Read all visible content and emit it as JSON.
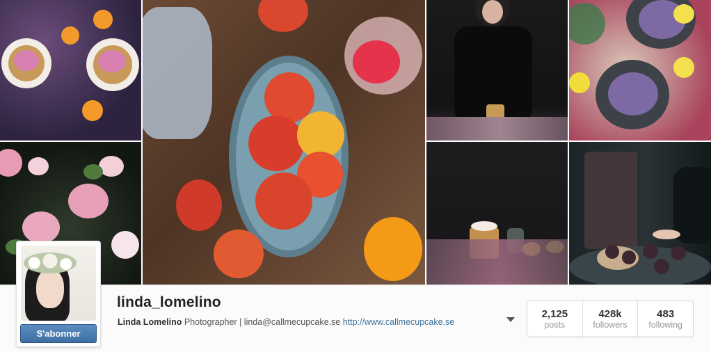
{
  "profile": {
    "username": "linda_lomelino",
    "full_name": "Linda Lomelino",
    "bio": "Photographer | linda@callmecupcake.se",
    "website": "http://www.callmecupcake.se",
    "follow_label": "S'abonner"
  },
  "stats": [
    {
      "value": "2,125",
      "label": "posts"
    },
    {
      "value": "428k",
      "label": "followers"
    },
    {
      "value": "483",
      "label": "following"
    }
  ],
  "colors": {
    "follow_button": "#4a7bb0",
    "link": "#3f729b",
    "bar_background": "#fbfbfb"
  },
  "icons": {
    "dropdown": "caret-down-icon"
  }
}
